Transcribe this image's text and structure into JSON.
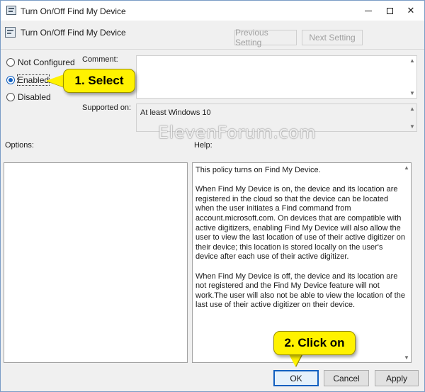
{
  "window": {
    "title": "Turn On/Off Find My Device",
    "controls": {
      "minimize_icon": "minimize-icon",
      "maximize_icon": "maximize-icon",
      "close_glyph": "✕"
    }
  },
  "header": {
    "policy_title": "Turn On/Off Find My Device",
    "previous_label": "Previous Setting",
    "next_label": "Next Setting"
  },
  "state": {
    "options": [
      {
        "label": "Not Configured",
        "checked": false
      },
      {
        "label": "Enabled",
        "checked": true
      },
      {
        "label": "Disabled",
        "checked": false
      }
    ]
  },
  "labels": {
    "comment": "Comment:",
    "supported_on": "Supported on:",
    "options": "Options:",
    "help": "Help:"
  },
  "supported_value": "At least Windows 10",
  "help_paragraphs": [
    "This policy turns on Find My Device.",
    "When Find My Device is on, the device and its location are registered in the cloud so that the device can be located when the user initiates a Find command from account.microsoft.com. On devices that are compatible with active digitizers, enabling Find My Device will also allow the user to view the last location of use of their active digitizer on their device; this location is stored locally on the user's device after each use of their active digitizer.",
    "When Find My Device is off, the device and its location are not registered and the Find My Device feature will not work.The user will also not be able to view the location of the last use of their active digitizer on their device."
  ],
  "footer": {
    "ok_label": "OK",
    "cancel_label": "Cancel",
    "apply_label": "Apply"
  },
  "watermark": "ElevenForum.com",
  "callouts": {
    "step1": "1. Select",
    "step2": "2. Click on"
  },
  "colors": {
    "accent": "#1260c0",
    "callout": "#fff200"
  }
}
